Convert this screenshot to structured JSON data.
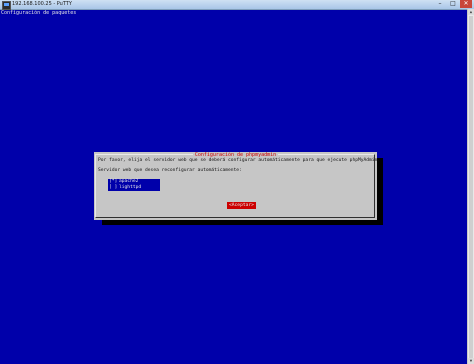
{
  "window": {
    "title": "192.168.100.25 - PuTTY",
    "controls": [
      "–",
      "□",
      "✕"
    ]
  },
  "terminal": {
    "header": "Configuración de paquetes"
  },
  "dialog": {
    "title": "Configuración de phpmyadmin",
    "message": "Por favor, elija el servidor web que se deberá configurar automáticamente para que ejecute phpMyAdmin.",
    "question": "Servidor web que desea reconfigurar automáticamente:",
    "options": [
      {
        "check": "[*]",
        "label": "apache2"
      },
      {
        "check": "[ ]",
        "label": "lighttpd"
      }
    ],
    "ok_button": "<Aceptar>"
  }
}
